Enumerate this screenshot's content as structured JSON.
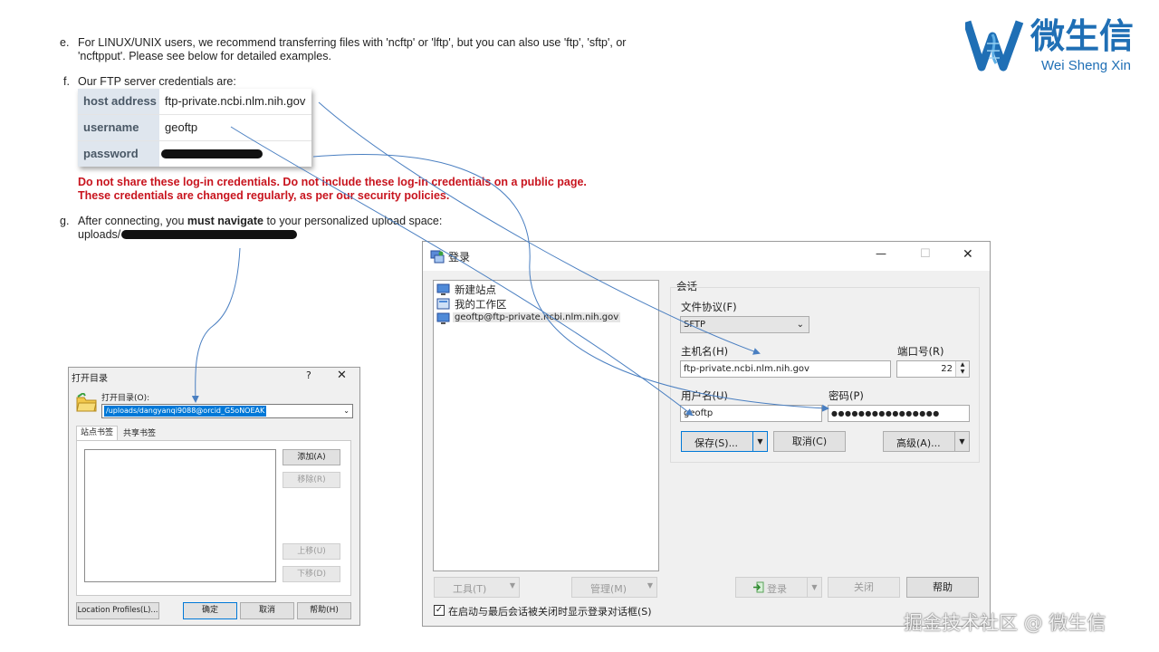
{
  "doc": {
    "item_e_marker": "e.",
    "item_e_line1": "For LINUX/UNIX users, we recommend transferring files with 'ncftp' or 'lftp', but you can also use 'ftp', 'sftp', or",
    "item_e_line2": "'ncftpput'. Please see below for detailed examples.",
    "item_f_marker": "f.",
    "item_f_text": "Our FTP server credentials are:",
    "credentials": [
      {
        "key": "host address",
        "value": "ftp-private.ncbi.nlm.nih.gov"
      },
      {
        "key": "username",
        "value": "geoftp"
      },
      {
        "key": "password",
        "value": ""
      }
    ],
    "warning_line1": "Do not share these log-in credentials. Do not include these log-in credentials on a public page.",
    "warning_line2": "These credentials are changed regularly, as per our security policies.",
    "item_g_marker": "g.",
    "item_g_before": "After connecting, you ",
    "item_g_bold": "must navigate",
    "item_g_after": " to your personalized upload space:",
    "upload_path_prefix": "uploads/"
  },
  "logo": {
    "brand_cn": "微生信",
    "brand_en": "Wei Sheng Xin",
    "colors": {
      "brand": "#1f6fb5"
    }
  },
  "open_dir_dialog": {
    "title": "打开目录",
    "help_symbol": "?",
    "close_symbol": "✕",
    "dir_label": "打开目录(O):",
    "dir_value": "/uploads/dangyanqi9088@orcid_G5oNOEAK",
    "tabs": [
      "站点书签",
      "共享书签"
    ],
    "buttons": {
      "add": "添加(A)",
      "remove": "移除(R)",
      "up": "上移(U)",
      "down": "下移(D)",
      "location_profiles": "Location Profiles(L)...",
      "ok": "确定",
      "cancel": "取消",
      "help": "帮助(H)"
    }
  },
  "login_dialog": {
    "title": "登录",
    "minimize_symbol": "—",
    "maximize_symbol": "☐",
    "close_symbol": "✕",
    "sites": [
      {
        "label": "新建站点",
        "icon": "monitor-icon"
      },
      {
        "label": "我的工作区",
        "icon": "workspace-icon"
      },
      {
        "label": "geoftp@ftp-private.ncbi.nlm.nih.gov",
        "icon": "monitor-icon"
      }
    ],
    "session_group": "会话",
    "protocol_label": "文件协议(F)",
    "protocol_value": "SFTP",
    "host_label": "主机名(H)",
    "host_value": "ftp-private.ncbi.nlm.nih.gov",
    "port_label": "端口号(R)",
    "port_value": "22",
    "user_label": "用户名(U)",
    "user_value": "geoftp",
    "password_label": "密码(P)",
    "password_value": "●●●●●●●●●●●●●●●●",
    "save_button": "保存(S)...",
    "cancel_button": "取消(C)",
    "advanced_button": "高级(A)...",
    "tools_button": "工具(T)",
    "manage_button": "管理(M)",
    "login_button": "登录",
    "close_button": "关闭",
    "help_button": "帮助",
    "checkbox_label": "在启动与最后会话被关闭时显示登录对话框(S)",
    "checkbox_checked": true
  },
  "watermark": "掘金技术社区 @ 微生信",
  "colors": {
    "arrow": "#4a7fc1",
    "warning": "#c8141e",
    "header_cell": "#dfe6ee"
  }
}
